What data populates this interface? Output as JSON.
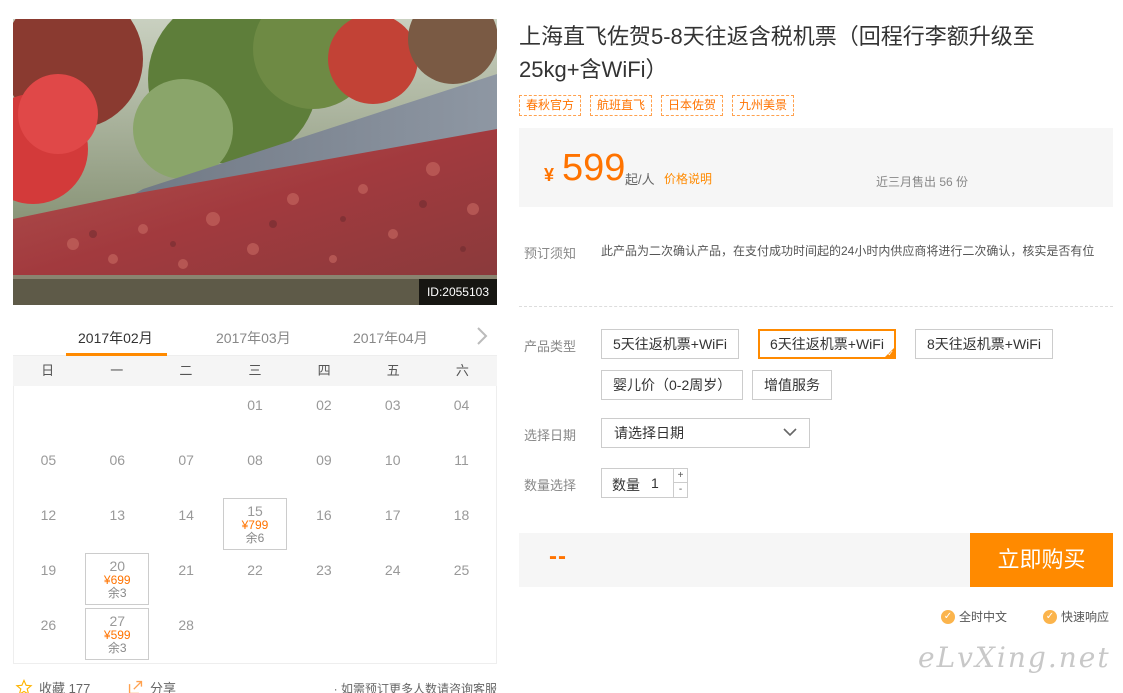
{
  "photo": {
    "id_label": "ID:2055103"
  },
  "calendar": {
    "months": [
      "2017年02月",
      "2017年03月",
      "2017年04月"
    ],
    "weekdays": [
      "日",
      "一",
      "二",
      "三",
      "四",
      "五",
      "六"
    ],
    "days": [
      {
        "day": "",
        "price": "",
        "remain": ""
      },
      {
        "day": "",
        "price": "",
        "remain": ""
      },
      {
        "day": "",
        "price": "",
        "remain": ""
      },
      {
        "day": "01",
        "price": "",
        "remain": ""
      },
      {
        "day": "02",
        "price": "",
        "remain": ""
      },
      {
        "day": "03",
        "price": "",
        "remain": ""
      },
      {
        "day": "04",
        "price": "",
        "remain": ""
      },
      {
        "day": "05",
        "price": "",
        "remain": ""
      },
      {
        "day": "06",
        "price": "",
        "remain": ""
      },
      {
        "day": "07",
        "price": "",
        "remain": ""
      },
      {
        "day": "08",
        "price": "",
        "remain": ""
      },
      {
        "day": "09",
        "price": "",
        "remain": ""
      },
      {
        "day": "10",
        "price": "",
        "remain": ""
      },
      {
        "day": "11",
        "price": "",
        "remain": ""
      },
      {
        "day": "12",
        "price": "",
        "remain": ""
      },
      {
        "day": "13",
        "price": "",
        "remain": ""
      },
      {
        "day": "14",
        "price": "",
        "remain": ""
      },
      {
        "day": "15",
        "price": "¥799",
        "remain": "余6"
      },
      {
        "day": "16",
        "price": "",
        "remain": ""
      },
      {
        "day": "17",
        "price": "",
        "remain": ""
      },
      {
        "day": "18",
        "price": "",
        "remain": ""
      },
      {
        "day": "19",
        "price": "",
        "remain": ""
      },
      {
        "day": "20",
        "price": "¥699",
        "remain": "余3"
      },
      {
        "day": "21",
        "price": "",
        "remain": ""
      },
      {
        "day": "22",
        "price": "",
        "remain": ""
      },
      {
        "day": "23",
        "price": "",
        "remain": ""
      },
      {
        "day": "24",
        "price": "",
        "remain": ""
      },
      {
        "day": "25",
        "price": "",
        "remain": ""
      },
      {
        "day": "26",
        "price": "",
        "remain": ""
      },
      {
        "day": "27",
        "price": "¥599",
        "remain": "余3"
      },
      {
        "day": "28",
        "price": "",
        "remain": ""
      }
    ]
  },
  "actions": {
    "favorite_label": "收藏 177",
    "share_label": "分享",
    "note": "· 如需预订更多人数请咨询客服"
  },
  "product": {
    "title": "上海直飞佐贺5-8天往返含税机票（回程行李额升级至25kg+含WiFi）",
    "tags": [
      "春秋官方",
      "航班直飞",
      "日本佐贺",
      "九州美景"
    ],
    "currency": "¥",
    "price": "599",
    "price_unit": "起/人",
    "price_explain": "价格说明",
    "sold": "近三月售出 56 份"
  },
  "booking": {
    "notice_label": "预订须知",
    "notice_text": "此产品为二次确认产品，在支付成功时间起的24小时内供应商将进行二次确认，核实是否有位",
    "type_label": "产品类型",
    "types": [
      "5天往返机票+WiFi",
      "6天往返机票+WiFi",
      "8天往返机票+WiFi",
      "婴儿价（0-2周岁）",
      "增值服务"
    ],
    "selected_type_index": 1,
    "date_label": "选择日期",
    "date_placeholder": "请选择日期",
    "qty_label": "数量选择",
    "qty_field_label": "数量",
    "qty_value": "1",
    "qty_plus": "+",
    "qty_minus": "-",
    "total": "--",
    "buy_label": "立即购买"
  },
  "badges": [
    "全时中文",
    "快速响应"
  ],
  "watermark": "eLvXing.net",
  "colors": {
    "accent": "#ff8a00",
    "price": "#ff7300",
    "tag_border": "#ffa14e"
  }
}
